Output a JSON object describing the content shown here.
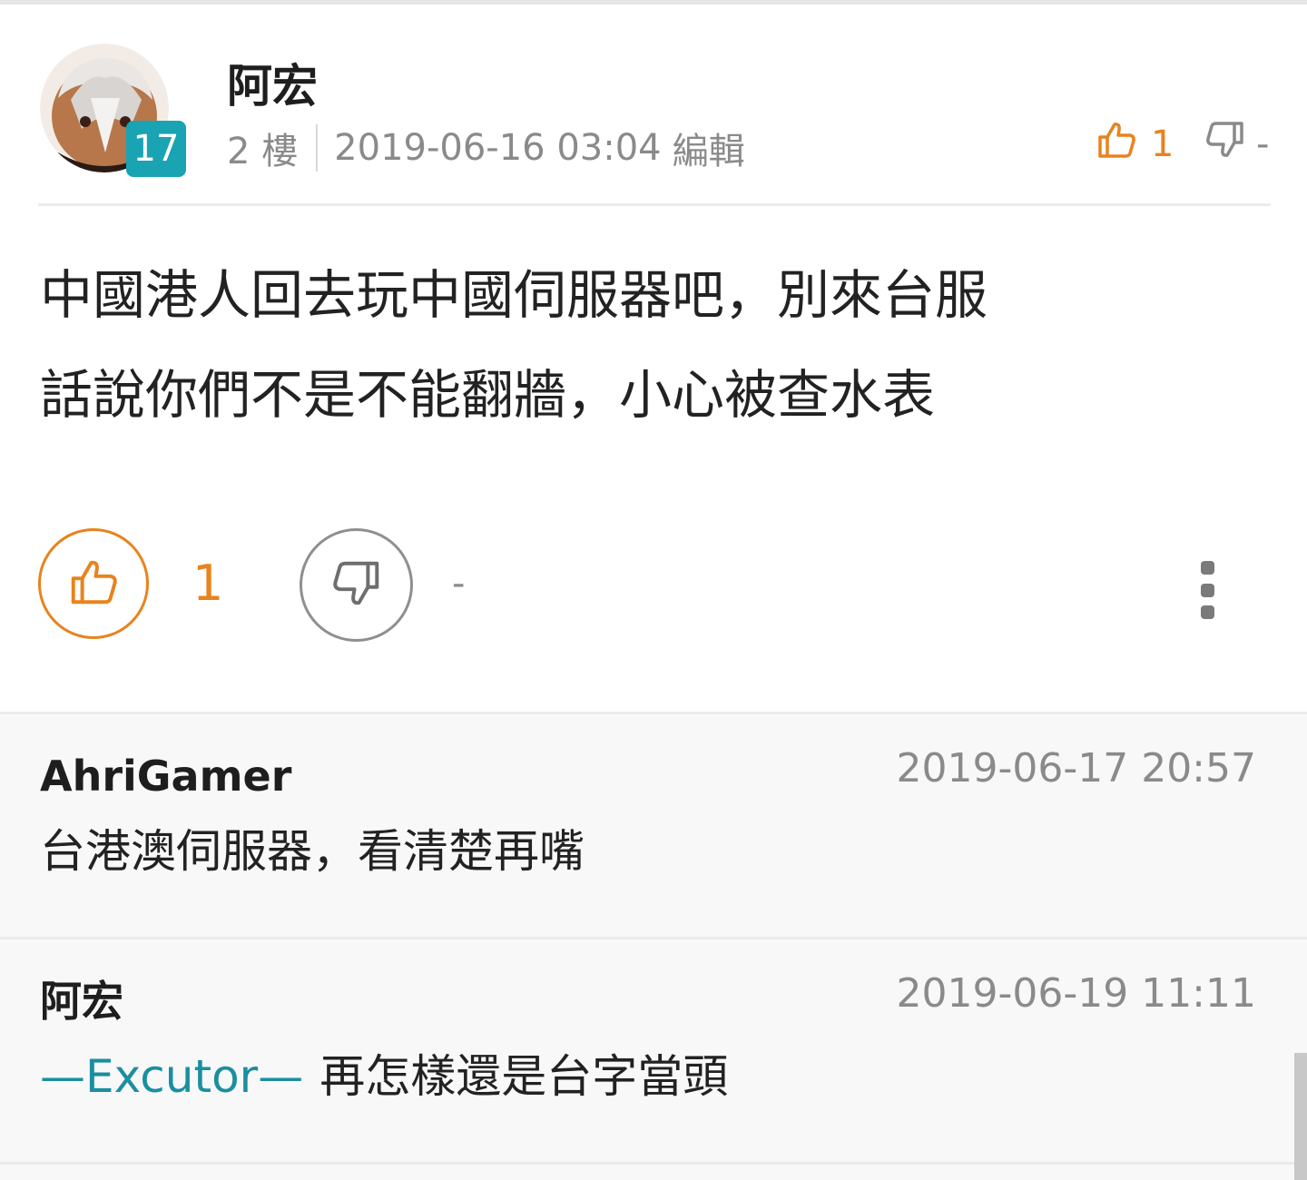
{
  "post": {
    "author": "阿宏",
    "level": "17",
    "floor": "2 樓",
    "timestamp": "2019-06-16 03:04",
    "edit_label": "編輯",
    "header_like_count": "1",
    "header_dislike_count": "-",
    "body_lines": [
      "中國港人回去玩中國伺服器吧，別來台服",
      "話說你們不是不能翻牆，小心被查水表"
    ],
    "gp_count": "1",
    "bp_count": "-"
  },
  "comments": [
    {
      "author": "AhriGamer",
      "time": "2019-06-17 20:57",
      "mention": "",
      "text": "台港澳伺服器，看清楚再嘴"
    },
    {
      "author": "阿宏",
      "time": "2019-06-19 11:11",
      "mention": "—Excutor—",
      "text": "再怎樣還是台字當頭"
    }
  ],
  "colors": {
    "accent": "#e8831d",
    "badge": "#1aa3b3",
    "mention": "#1a8fa0",
    "muted": "#8a8a8a"
  },
  "icons": [
    "avatar",
    "thumbs-up-icon",
    "thumbs-down-icon",
    "more-vertical-icon"
  ]
}
